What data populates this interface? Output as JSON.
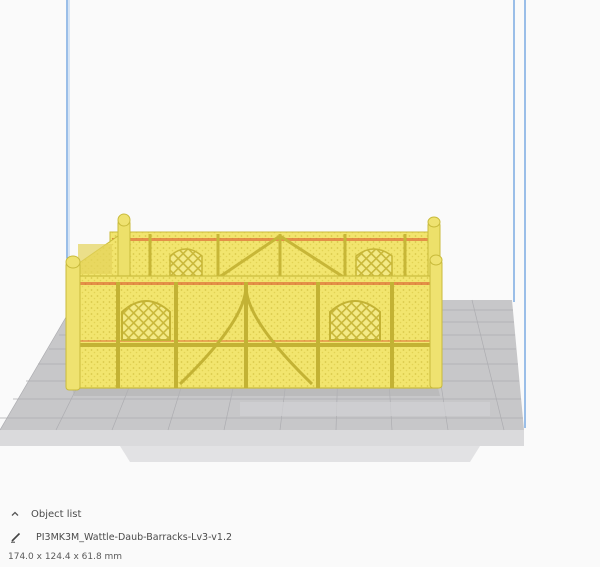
{
  "viewport": {
    "model_color": "#f0e46a",
    "model_shadow": "#c9bb3c",
    "plate_color": "#c4c4c6",
    "grid_color": "#a9a9ad",
    "build_volume_color": "#4d8fd9"
  },
  "object_panel": {
    "header_label": "Object list",
    "header_icon": "chevron-up-icon",
    "object_name": "PI3MK3M_Wattle-Daub-Barracks-Lv3-v1.2",
    "object_icon": "pencil-icon",
    "dimensions": "174.0 x 124.4 x 61.8 mm"
  }
}
